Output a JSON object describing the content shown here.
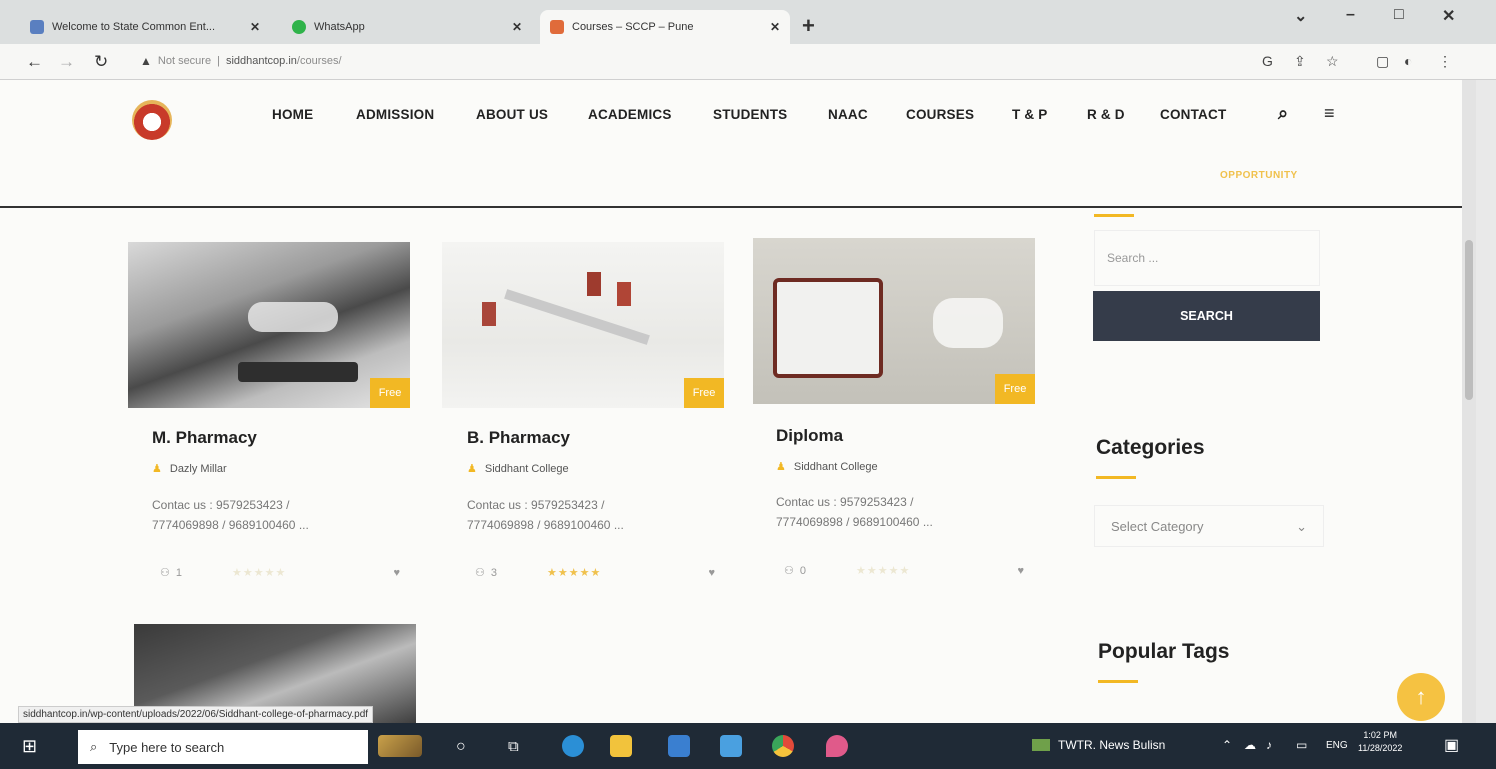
{
  "browser": {
    "tabs": [
      {
        "title": "Welcome to State Common Ent...",
        "favicon_color": "#5a7fc0"
      },
      {
        "title": "WhatsApp",
        "favicon_color": "#2fb34a"
      },
      {
        "title": "Courses – SCCP – Pune",
        "favicon_color": "#e06b3a"
      }
    ],
    "new_tab": "+",
    "url_warning": "Not secure",
    "url_sep": "|",
    "url_host": "siddhantcop.in",
    "url_path": "/courses/"
  },
  "nav": {
    "items": [
      "HOME",
      "ADMISSION",
      "ABOUT US",
      "ACADEMICS",
      "STUDENTS",
      "NAAC",
      "COURSES",
      "T & P",
      "R & D",
      "CONTACT"
    ],
    "sub_item": "OPPORTUNITY"
  },
  "courses": [
    {
      "title": "M. Pharmacy",
      "author": "Dazly Millar",
      "desc_line1": "Contac us : 9579253423 /",
      "desc_line2": "7774069898 / 9689100460 ...",
      "badge": "Free",
      "students": "1",
      "stars_filled": false
    },
    {
      "title": "B. Pharmacy",
      "author": "Siddhant College",
      "desc_line1": "Contac us : 9579253423 /",
      "desc_line2": "7774069898 / 9689100460 ...",
      "badge": "Free",
      "students": "3",
      "stars_filled": true
    },
    {
      "title": "Diploma",
      "author": "Siddhant College",
      "desc_line1": "Contac us : 9579253423 /",
      "desc_line2": "7774069898 / 9689100460 ...",
      "badge": "Free",
      "students": "0",
      "stars_filled": false
    }
  ],
  "sidebar": {
    "search_placeholder": "Search ...",
    "search_button": "SEARCH",
    "categories_heading": "Categories",
    "category_select": "Select Category",
    "tags_heading": "Popular Tags"
  },
  "status_url": "siddhantcop.in/wp-content/uploads/2022/06/Siddhant-college-of-pharmacy.pdf",
  "taskbar": {
    "search_placeholder": "Type here to search",
    "news": "TWTR. News Bulisn",
    "lang": "ENG",
    "time": "1:02 PM",
    "date": "11/28/2022"
  },
  "colors": {
    "accent": "#f2b824",
    "button_dark": "#353c4a"
  }
}
